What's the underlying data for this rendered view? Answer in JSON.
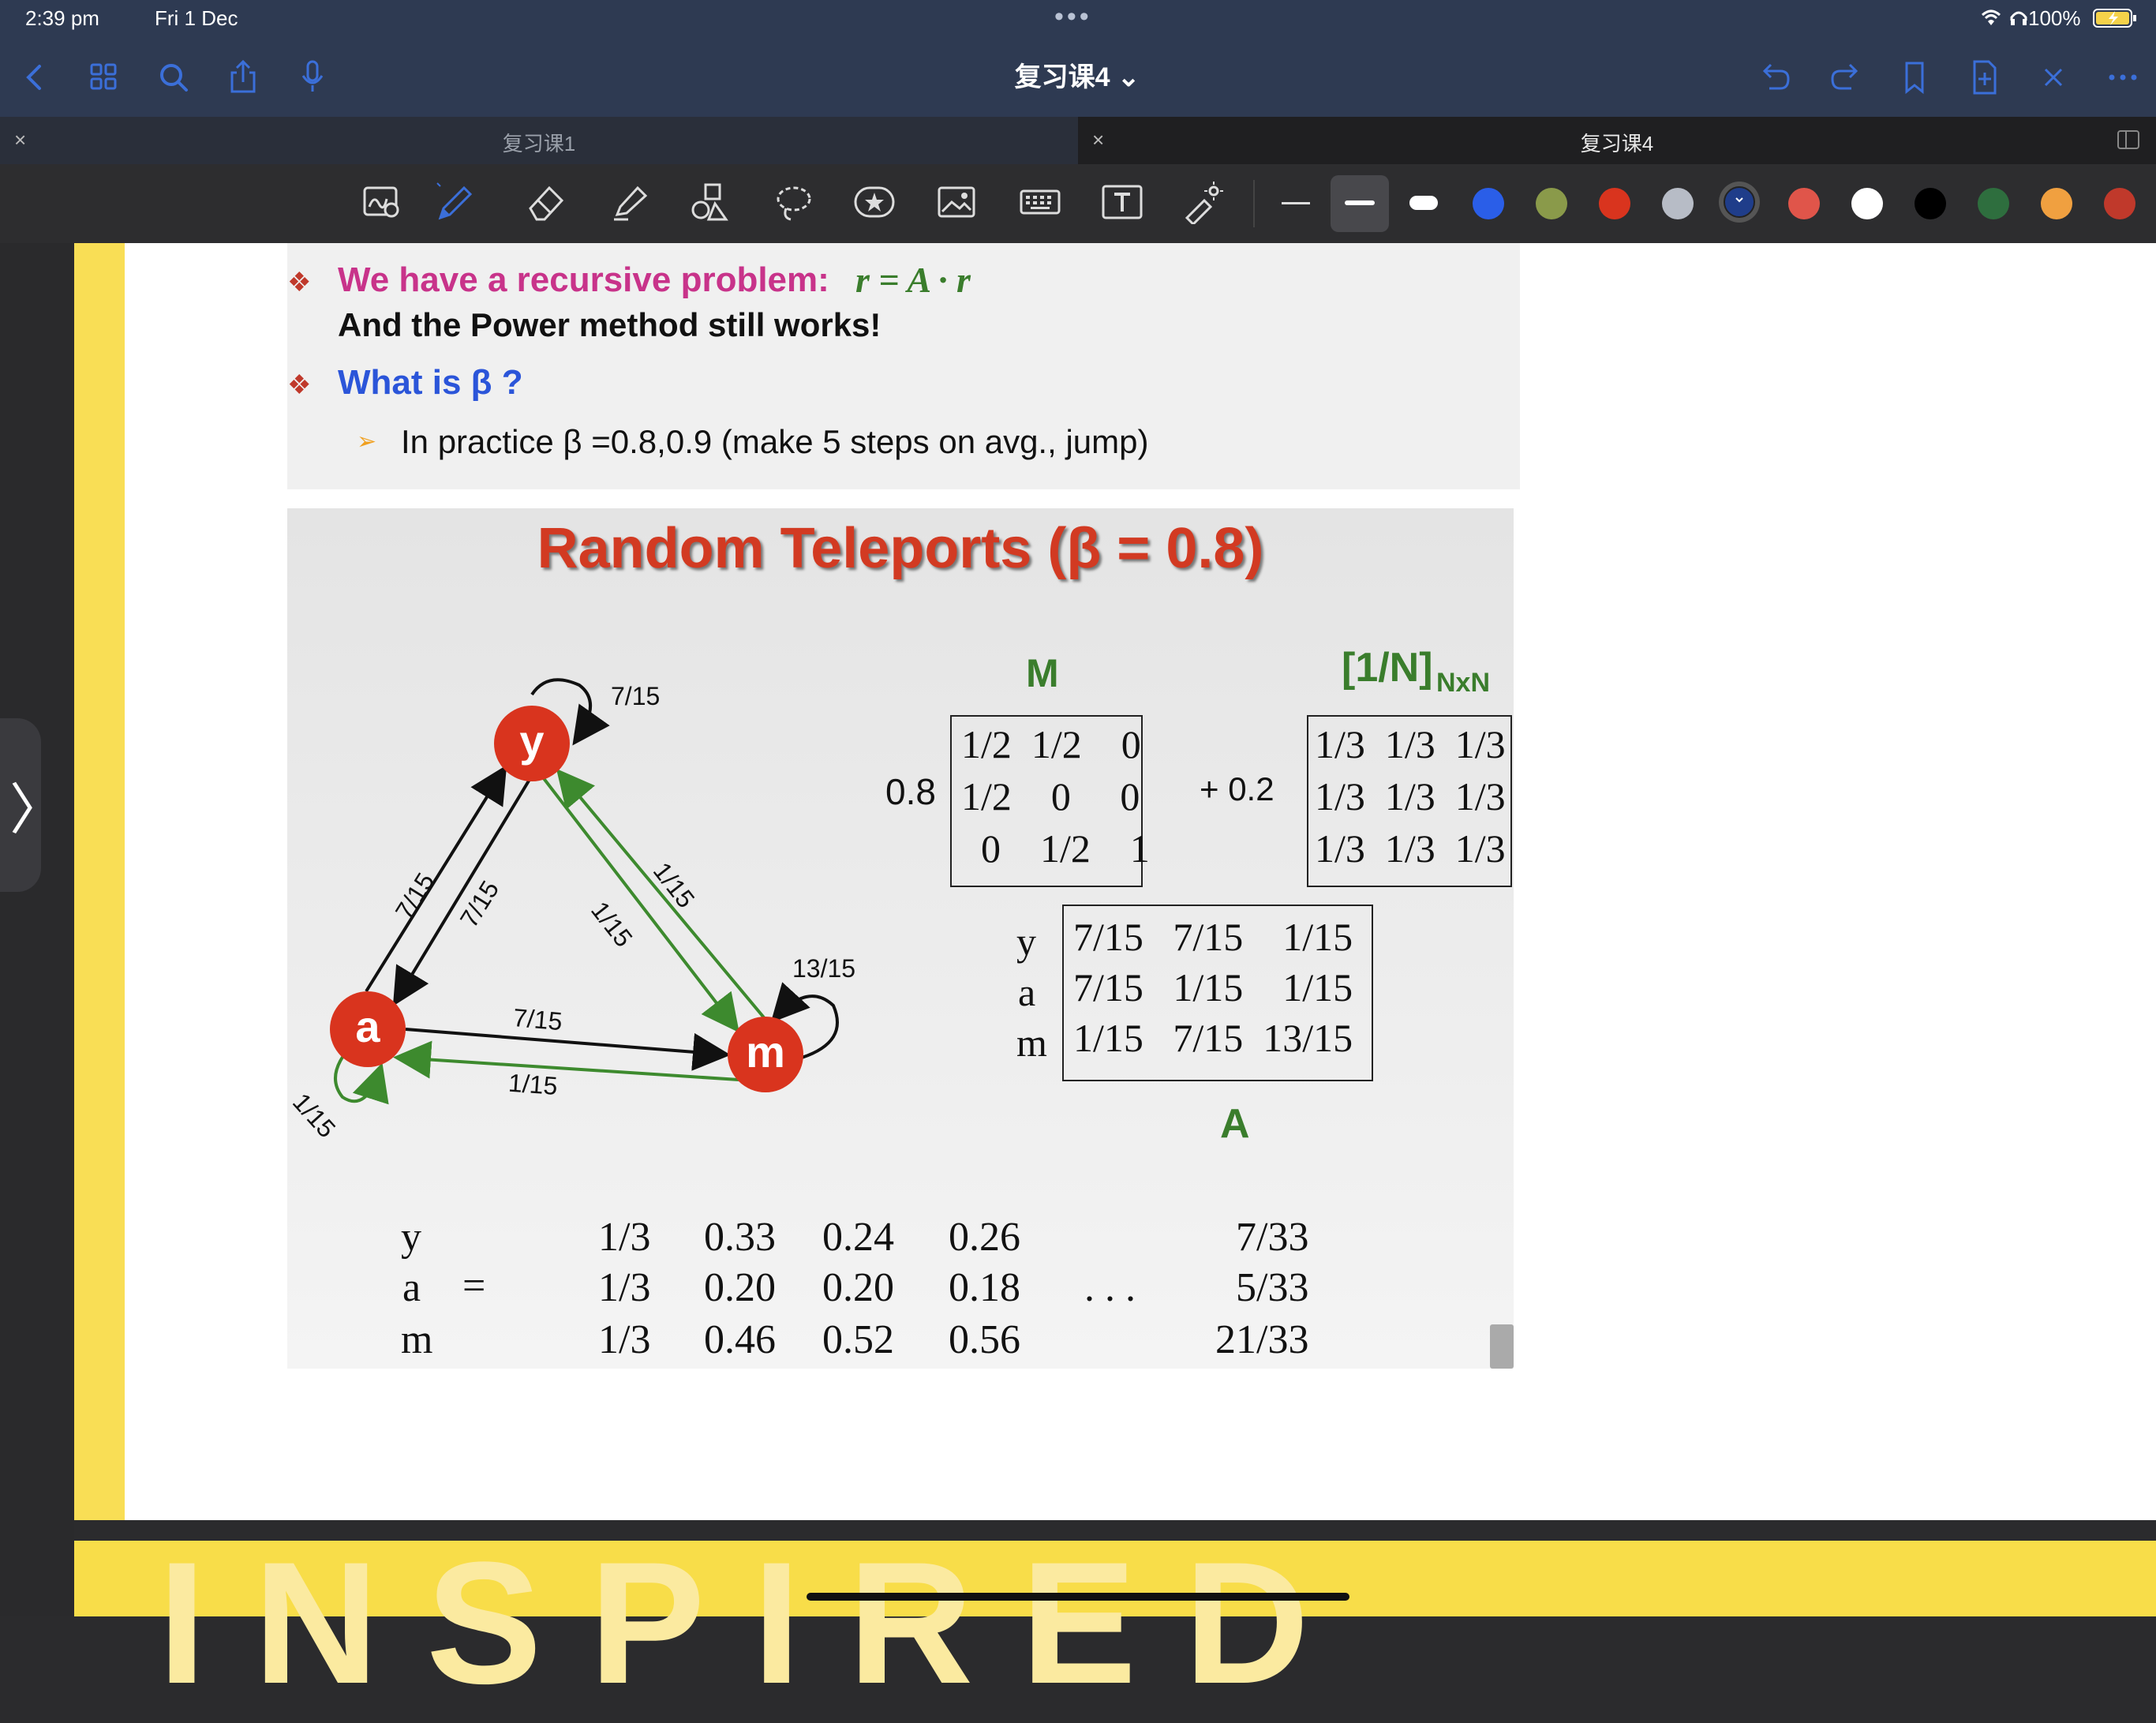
{
  "status": {
    "time": "2:39 pm",
    "date": "Fri 1 Dec",
    "dots": "•••",
    "battery": "100%"
  },
  "toolbar": {
    "doc_title": "复习课4 ⌄"
  },
  "tabs": [
    {
      "label": "复习课1",
      "close": "×"
    },
    {
      "label": "复习课4",
      "close": "×"
    }
  ],
  "icons": {
    "left": [
      "back-icon",
      "grid-icon",
      "search-icon",
      "share-icon",
      "mic-icon"
    ],
    "right": [
      "undo-icon",
      "redo-icon",
      "bookmark-icon",
      "add-page-icon",
      "close-icon",
      "more-icon"
    ],
    "tools": [
      "zoom-write-icon",
      "pen-icon",
      "eraser-icon",
      "highlighter-icon",
      "shapes-icon",
      "lasso-icon",
      "sticker-icon",
      "image-icon",
      "keyboard-icon",
      "textbox-icon",
      "laser-icon"
    ]
  },
  "colors": {
    "swatches": [
      "#2a5ee8",
      "#8a9a4a",
      "#d9341e",
      "#b7bcc6",
      "#1f3d8a",
      "#e0554a",
      "#ffffff",
      "#000000",
      "#2e6e3e",
      "#f0a040",
      "#c0392b"
    ],
    "accent": "#3b6fd9"
  },
  "sidebar": {
    "arrow": "〉"
  },
  "slide1": {
    "bullet": "❖",
    "line1": "We have a recursive problem:",
    "line1_eq": "r = A · r",
    "line2": "And the Power method still works!",
    "line3": "What is β ?",
    "sub_bullet": "➢",
    "line4": "In practice β =0.8,0.9 (make 5 steps on avg., jump)"
  },
  "slide2": {
    "title": "Random Teleports (β = 0.8)",
    "graph": {
      "nodes": [
        "y",
        "a",
        "m"
      ],
      "edge_labels": {
        "y_loop": "7/15",
        "a_to_y": "7/15",
        "y_to_a": "7/15",
        "y_to_m": "1/15",
        "m_to_y": "1/15",
        "m_loop": "13/15",
        "a_to_m": "7/15",
        "m_to_a": "1/15",
        "a_loop": "1/15"
      }
    },
    "M_label": "M",
    "N_label": "[1/N]",
    "N_sub": "NxN",
    "coef1": "0.8",
    "coef2": "+ 0.2",
    "M_rows": [
      "1/2  1/2    0",
      "1/2    0     0",
      "  0    1/2    1"
    ],
    "N_rows": [
      "1/3  1/3  1/3",
      "1/3  1/3  1/3",
      "1/3  1/3  1/3"
    ],
    "A_label": "A",
    "A_row_labels": [
      "y",
      "a",
      "m"
    ],
    "A_rows": [
      "7/15   7/15    1/15",
      "7/15   1/15    1/15",
      "1/15   7/15  13/15"
    ],
    "vec_labels": [
      "y",
      "a",
      "m"
    ],
    "vec_eq": "=",
    "vec_cols": [
      [
        "1/3",
        "1/3",
        "1/3"
      ],
      [
        "0.33",
        "0.20",
        "0.46"
      ],
      [
        "0.24",
        "0.20",
        "0.52"
      ],
      [
        "0.26",
        "0.18",
        "0.56"
      ]
    ],
    "vec_dots": ". . .",
    "vec_final": [
      "7/33",
      "5/33",
      "21/33"
    ]
  },
  "bottom_banner": "INSPIRED"
}
